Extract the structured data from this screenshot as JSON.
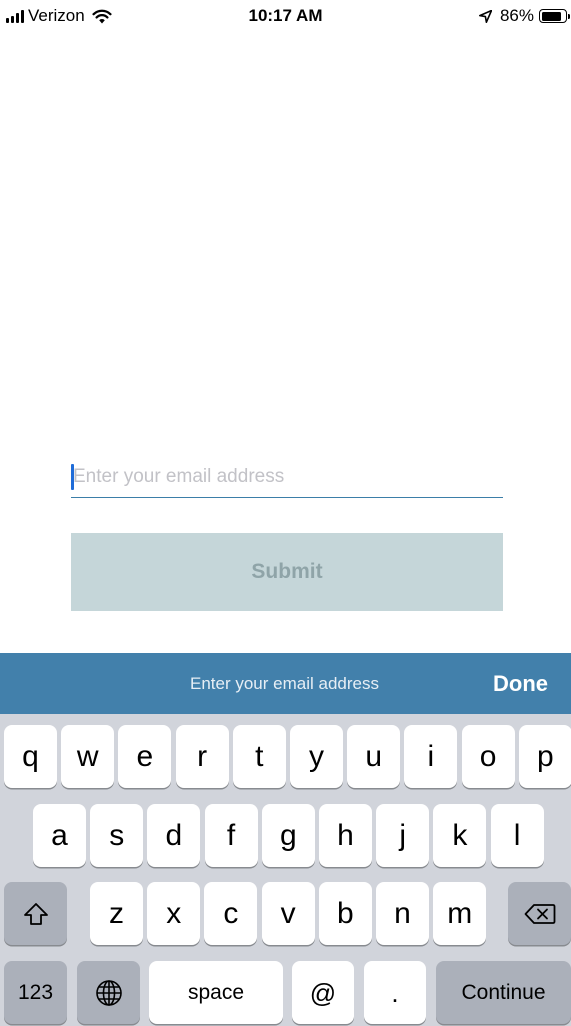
{
  "status_bar": {
    "carrier": "Verizon",
    "time": "10:17 AM",
    "battery_percent": "86%",
    "battery_level": 0.86,
    "icons": [
      "signal-bars-icon",
      "wifi-icon",
      "location-arrow-icon",
      "battery-icon"
    ]
  },
  "form": {
    "email_placeholder": "Enter your email address",
    "submit_label": "Submit"
  },
  "keyboard_toolbar": {
    "title": "Enter your email address",
    "done_label": "Done"
  },
  "keyboard": {
    "row1": [
      "q",
      "w",
      "e",
      "r",
      "t",
      "y",
      "u",
      "i",
      "o",
      "p"
    ],
    "row2": [
      "a",
      "s",
      "d",
      "f",
      "g",
      "h",
      "j",
      "k",
      "l"
    ],
    "row3": [
      "z",
      "x",
      "c",
      "v",
      "b",
      "n",
      "m"
    ],
    "numbers_label": "123",
    "space_label": "space",
    "at_label": "@",
    "dot_label": ".",
    "continue_label": "Continue",
    "icons": [
      "shift-icon",
      "backspace-icon",
      "globe-icon"
    ]
  },
  "colors": {
    "accent": "#4280ab",
    "field_underline": "#3b7ea8",
    "submit_disabled_bg": "#c5d6d9",
    "keyboard_bg": "#d1d4db"
  }
}
